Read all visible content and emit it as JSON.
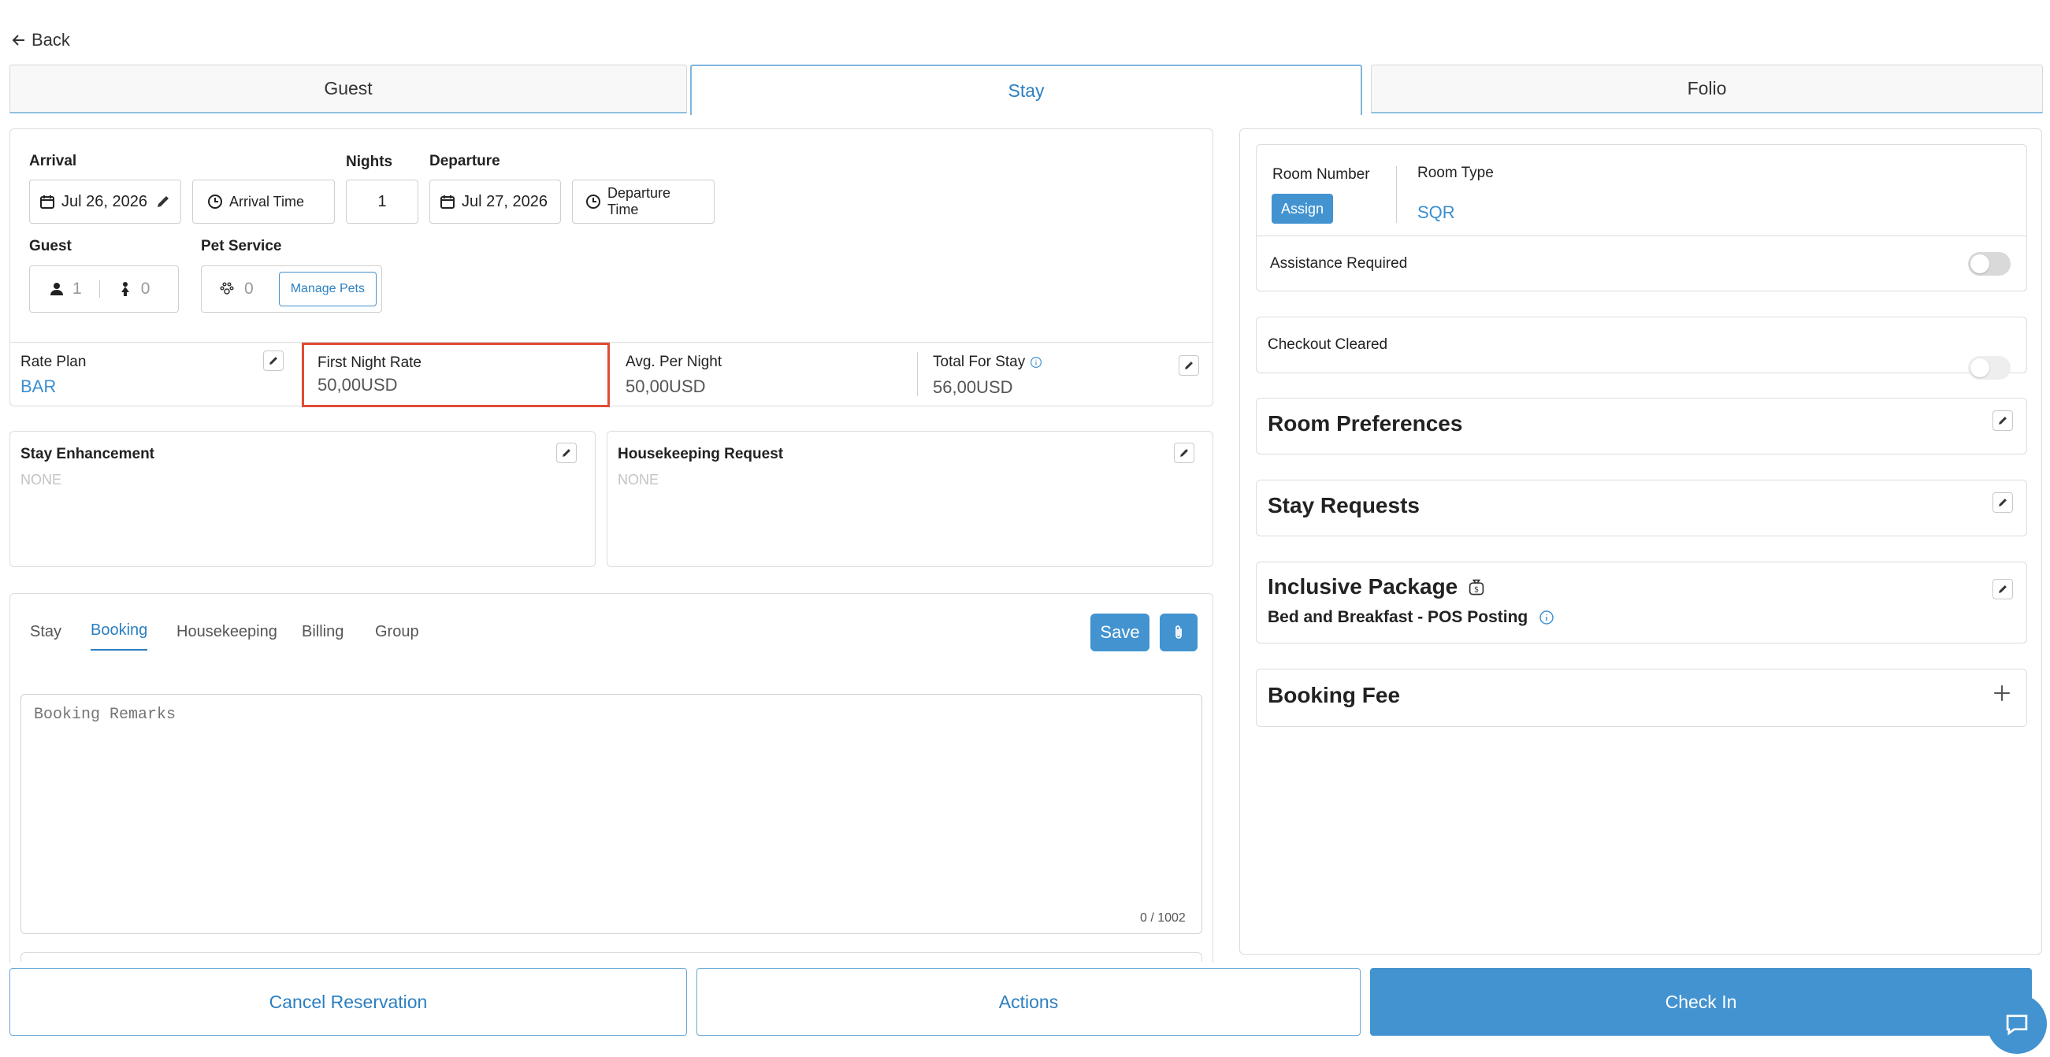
{
  "nav": {
    "back_label": "Back"
  },
  "tabs": [
    {
      "label": "Guest"
    },
    {
      "label": "Stay"
    },
    {
      "label": "Folio"
    }
  ],
  "stay": {
    "arrival_label": "Arrival",
    "arrival_date": "Jul 26, 2026",
    "arrival_time": "Arrival Time",
    "nights_label": "Nights",
    "nights_value": "1",
    "departure_label": "Departure",
    "departure_date": "Jul 27, 2026",
    "departure_time": "Departure Time",
    "guest_label": "Guest",
    "adults": "1",
    "children": "0",
    "pet_label": "Pet Service",
    "pets": "0",
    "manage_pets": "Manage Pets"
  },
  "rates": {
    "rate_plan_label": "Rate Plan",
    "rate_plan_value": "BAR",
    "first_night_label": "First Night Rate",
    "first_night_value": "50,00USD",
    "avg_label": "Avg. Per Night",
    "avg_value": "50,00USD",
    "total_label": "Total For Stay",
    "total_value": "56,00USD"
  },
  "enhancement": {
    "label": "Stay Enhancement",
    "value": "NONE"
  },
  "housekeeping": {
    "label": "Housekeeping Request",
    "value": "NONE"
  },
  "remarks": {
    "tabs": [
      "Stay",
      "Booking",
      "Housekeeping",
      "Billing",
      "Group"
    ],
    "active_tab": "Booking",
    "save_label": "Save",
    "placeholder": "Booking Remarks",
    "counter": "0 / 1002"
  },
  "room": {
    "number_label": "Room Number",
    "assign_label": "Assign",
    "type_label": "Room Type",
    "type_value": "SQR",
    "assistance_label": "Assistance Required",
    "checkout_label": "Checkout Cleared"
  },
  "right_sections": {
    "room_preferences": "Room Preferences",
    "stay_requests": "Stay Requests",
    "inclusive_package": "Inclusive Package",
    "package_item": "Bed and Breakfast - POS Posting",
    "booking_fee": "Booking Fee"
  },
  "footer": {
    "cancel_label": "Cancel Reservation",
    "actions_label": "Actions",
    "checkin_label": "Check In"
  },
  "colors": {
    "accent": "#4293d0",
    "highlight_border": "#e04b35"
  }
}
